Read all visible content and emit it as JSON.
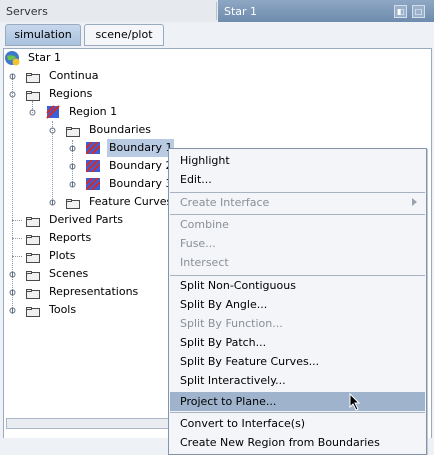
{
  "window": {
    "servers_label": "Servers",
    "active_tab": "Star 1"
  },
  "tabs": [
    {
      "label": "simulation",
      "active": true
    },
    {
      "label": "scene/plot",
      "active": false
    }
  ],
  "tree": {
    "root": "Star 1",
    "continua": "Continua",
    "regions": "Regions",
    "region1": "Region 1",
    "boundaries": "Boundaries",
    "boundary1": "Boundary 1",
    "boundary2": "Boundary 2",
    "boundary3": "Boundary 3",
    "feature_curves": "Feature Curves",
    "derived_parts": "Derived Parts",
    "reports": "Reports",
    "plots": "Plots",
    "scenes": "Scenes",
    "representations": "Representations",
    "tools": "Tools"
  },
  "context_menu": {
    "highlight": "Highlight",
    "edit": "Edit...",
    "create_interface": "Create Interface",
    "combine": "Combine",
    "fuse": "Fuse...",
    "intersect": "Intersect",
    "split_non_contiguous": "Split Non-Contiguous",
    "split_by_angle": "Split By Angle...",
    "split_by_function": "Split By Function...",
    "split_by_patch": "Split By Patch...",
    "split_by_feature_curves": "Split By Feature Curves...",
    "split_interactively": "Split Interactively...",
    "project_to_plane": "Project to Plane...",
    "convert_to_interfaces": "Convert to Interface(s)",
    "create_new_region": "Create New Region from Boundaries"
  },
  "colors": {
    "selection": "#b8cbe3",
    "menu_highlight": "#9fb3cc",
    "folder": "#e8e8e8",
    "boundary_icon": "#3a5fd9",
    "boundary_stripe": "#d42a2a"
  }
}
